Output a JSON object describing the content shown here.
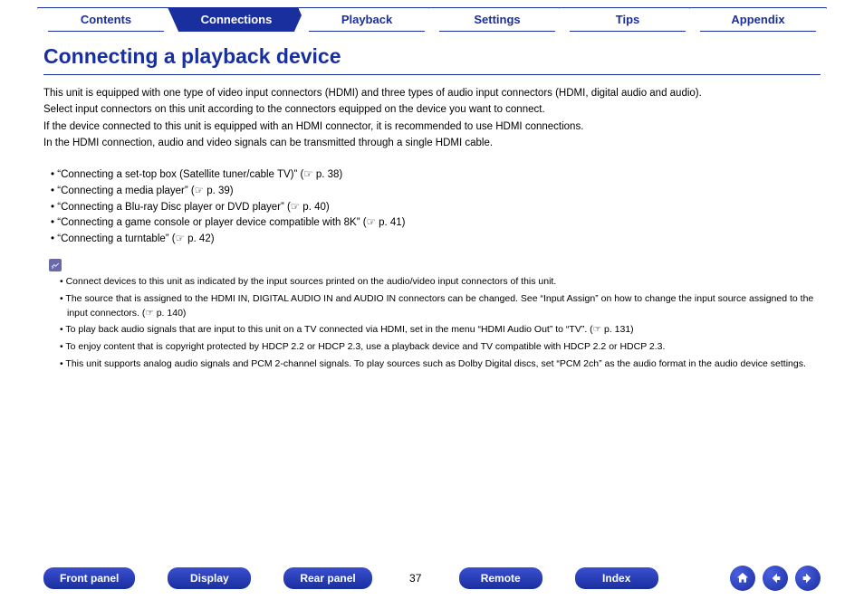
{
  "tabs": [
    {
      "label": "Contents",
      "active": false
    },
    {
      "label": "Connections",
      "active": true
    },
    {
      "label": "Playback",
      "active": false
    },
    {
      "label": "Settings",
      "active": false
    },
    {
      "label": "Tips",
      "active": false
    },
    {
      "label": "Appendix",
      "active": false
    }
  ],
  "title": "Connecting a playback device",
  "intro": [
    "This unit is equipped with one type of video input connectors (HDMI) and three types of audio input connectors (HDMI, digital audio and audio).",
    "Select input connectors on this unit according to the connectors equipped on the device you want to connect.",
    "If the device connected to this unit is equipped with an HDMI connector, it is recommended to use HDMI connections.",
    "In the HDMI connection, audio and video signals can be transmitted through a single HDMI cable."
  ],
  "links": [
    "“Connecting a set-top box (Satellite tuner/cable TV)” (☞ p. 38)",
    "“Connecting a media player” (☞ p. 39)",
    "“Connecting a Blu-ray Disc player or DVD player” (☞ p. 40)",
    "“Connecting a game console or player device compatible with 8K” (☞ p. 41)",
    "“Connecting a turntable” (☞ p. 42)"
  ],
  "notes": [
    "Connect devices to this unit as indicated by the input sources printed on the audio/video input connectors of this unit.",
    "The source that is assigned to the HDMI IN, DIGITAL AUDIO IN and AUDIO IN connectors can be changed. See “Input Assign” on how to change the input source assigned to the input connectors.  (☞ p. 140)",
    "To play back audio signals that are input to this unit on a TV connected via HDMI, set in the menu “HDMI Audio Out” to “TV”.  (☞ p. 131)",
    "To enjoy content that is copyright protected by HDCP 2.2 or HDCP 2.3, use a playback device and TV compatible with HDCP 2.2 or HDCP 2.3.",
    "This unit supports analog audio signals and PCM 2-channel signals. To play sources such as Dolby Digital discs, set “PCM 2ch” as the audio format in the audio device settings."
  ],
  "bottom": {
    "front": "Front panel",
    "display": "Display",
    "rear": "Rear panel",
    "page": "37",
    "remote": "Remote",
    "index": "Index"
  }
}
